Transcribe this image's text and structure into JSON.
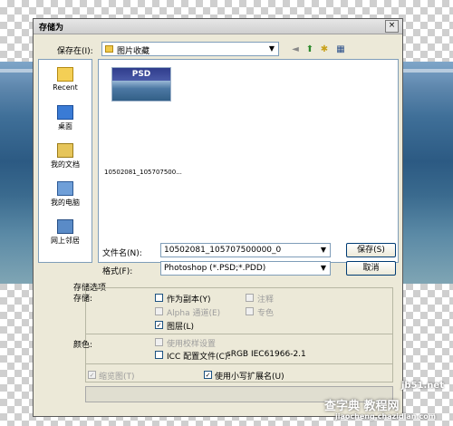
{
  "dialog": {
    "title": "存储为",
    "close_glyph": "×",
    "save_in_label": "保存在(I):",
    "save_in_value": "图片收藏",
    "places": [
      {
        "label": "Recent"
      },
      {
        "label": "桌面"
      },
      {
        "label": "我的文档"
      },
      {
        "label": "我的电脑"
      },
      {
        "label": "网上邻居"
      }
    ],
    "thumbnail_badge": "PSD",
    "thumbnail_filename": "10502081_105707500...",
    "filename_label": "文件名(N):",
    "filename_value": "10502081_105707500000_0",
    "format_label": "格式(F):",
    "format_value": "Photoshop (*.PSD;*.PDD)",
    "save_button": "保存(S)",
    "cancel_button": "取消",
    "options_label": "存储选项",
    "store_label": "存储:",
    "options": {
      "as_copy": "作为副本(Y)",
      "notes": "注释",
      "alpha": "Alpha 通道(E)",
      "spot": "专色",
      "layers": "图层(L)"
    },
    "color_label": "颜色:",
    "proof_setup": "使用校样设置",
    "icc_profile": "ICC 配置文件(C):",
    "icc_value": "sRGB IEC61966-2.1",
    "thumbnail_option": "缩览图(T)",
    "lowercase_ext": "使用小写扩展名(U)"
  },
  "watermark": {
    "site": "jb51.net",
    "text": "查字典 教程网",
    "url": "jiaocheng.chazidian.com"
  }
}
